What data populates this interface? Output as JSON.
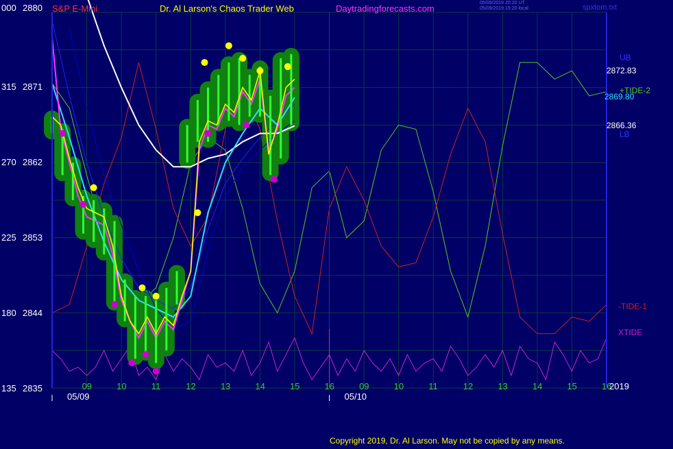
{
  "header": {
    "symbol": "S&P E-Mini",
    "title": "Dr. Al Larson's Chaos Trader Web",
    "site": "Daytradingforecasts.com",
    "stamp_ut": "05/09/2019 20:20 UT",
    "stamp_local": "05/09/2019 15:20 local",
    "filename": "spxtom.txt"
  },
  "copyright": "Copyright 2019, Dr. Al Larson. May not be copied by any means.",
  "colors": {
    "background": "#000066",
    "grid": "#0a3a40",
    "price_hull": "#108010",
    "price_bar": "#30ff30",
    "price_close": "#ffff00",
    "high_marker": "#ffff00",
    "low_marker": "#cc00cc",
    "magenta_avg": "#ff33ff",
    "cyan_avg": "#33ddff",
    "white_avg": "#ffffff",
    "blue_avg1": "#2020ff",
    "blue_avg2": "#0000cc",
    "tide_plus": "#55cc22",
    "tide_minus": "#cc2222",
    "xtide": "#cc22cc",
    "now_line": "#2222dd"
  },
  "chart_data": {
    "type": "line",
    "title": "S&P E-Mini",
    "xlabel": "",
    "ylabel": "",
    "grid": true,
    "hour_ticks": [
      "09",
      "10",
      "11",
      "12",
      "13",
      "14",
      "15",
      "16",
      "09",
      "10",
      "11",
      "12",
      "13",
      "14",
      "15",
      "16"
    ],
    "date_labels": [
      "05/09",
      "05/10"
    ],
    "year_label": "2019",
    "y_ticks": [
      {
        "left": "135",
        "price": "2835"
      },
      {
        "left": "180",
        "price": "2844"
      },
      {
        "left": "225",
        "price": "2853"
      },
      {
        "left": "270",
        "price": "2862"
      },
      {
        "left": "315",
        "price": "2871"
      },
      {
        "left": "000",
        "price": "2880"
      }
    ],
    "ylim": [
      2835,
      2880
    ],
    "right_labels": {
      "ub": "UB",
      "ub_value": "2872.83",
      "cyan_value": "2869.80",
      "lb_value": "2866.36",
      "lb": "LB",
      "tide2": "+TIDE-2",
      "tide1": "-TIDE-1",
      "xtide": "XTIDE"
    },
    "series": [
      {
        "name": "price_close",
        "x": [
          0.0,
          0.25,
          0.5,
          0.75,
          1.0,
          1.25,
          1.5,
          1.75,
          2.0,
          2.25,
          2.5,
          2.75,
          3.0,
          3.25,
          3.5,
          3.75,
          4.0,
          4.25,
          4.5,
          4.75,
          5.0,
          5.25,
          5.5,
          5.75,
          6.0,
          6.25,
          6.5,
          6.75,
          7.0
        ],
        "values": [
          2867.5,
          2866.5,
          2862.5,
          2859.0,
          2856.5,
          2856.0,
          2855.5,
          2852.0,
          2846.0,
          2843.0,
          2841.5,
          2843.5,
          2841.5,
          2843.5,
          2842.5,
          2846.0,
          2849.0,
          2864.5,
          2867.0,
          2866.5,
          2869.0,
          2868.0,
          2871.0,
          2869.5,
          2873.0,
          2863.0,
          2866.5,
          2871.0,
          2872.0
        ]
      },
      {
        "name": "magenta_avg",
        "x": [
          0.0,
          0.25,
          0.5,
          0.75,
          1.0,
          1.25,
          1.5,
          1.75,
          2.0,
          2.25,
          2.5,
          2.75,
          3.0,
          3.25,
          3.5,
          3.75,
          4.0,
          4.25,
          4.5,
          4.75,
          5.0,
          5.25,
          5.5,
          5.75,
          6.0,
          6.25,
          6.5,
          6.75,
          7.0
        ],
        "values": [
          2877.0,
          2866.0,
          2862.0,
          2858.0,
          2855.5,
          2855.0,
          2854.5,
          2851.0,
          2845.5,
          2843.0,
          2841.0,
          2843.0,
          2841.0,
          2843.0,
          2842.0,
          2845.5,
          2849.0,
          2863.5,
          2866.5,
          2866.0,
          2868.5,
          2867.5,
          2870.5,
          2869.0,
          2872.0,
          2863.5,
          2866.0,
          2870.0,
          2871.0
        ]
      },
      {
        "name": "cyan_avg",
        "x": [
          0.0,
          0.5,
          1.0,
          1.5,
          2.0,
          2.5,
          3.0,
          3.5,
          4.0,
          4.5,
          5.0,
          5.5,
          6.0,
          6.5,
          7.0
        ],
        "values": [
          2871.5,
          2865.0,
          2858.0,
          2852.5,
          2848.0,
          2845.5,
          2844.5,
          2843.5,
          2846.0,
          2856.0,
          2862.0,
          2865.5,
          2868.5,
          2866.5,
          2869.8
        ]
      },
      {
        "name": "white_avg",
        "x": [
          1.0,
          1.5,
          2.0,
          2.5,
          3.0,
          3.5,
          4.0,
          4.5,
          5.0,
          5.5,
          6.0,
          6.5,
          7.0
        ],
        "values": [
          2882.0,
          2876.0,
          2871.0,
          2866.5,
          2863.5,
          2861.5,
          2861.5,
          2862.5,
          2863.0,
          2864.5,
          2865.5,
          2865.5,
          2866.4
        ]
      },
      {
        "name": "blue_avg1",
        "x": [
          0.0,
          0.5,
          1.0,
          1.5,
          2.0,
          2.5,
          3.0,
          3.5,
          4.0,
          4.5,
          5.0,
          5.5,
          6.0,
          6.5,
          7.0
        ],
        "values": [
          2879.0,
          2870.0,
          2862.0,
          2855.5,
          2850.5,
          2847.0,
          2845.5,
          2844.5,
          2847.0,
          2854.0,
          2859.5,
          2862.5,
          2865.0,
          2867.0,
          2869.0
        ]
      },
      {
        "name": "blue_avg2",
        "x": [
          0.5,
          1.0,
          1.5,
          2.0,
          2.5,
          3.0,
          3.5,
          4.0,
          4.5,
          5.0,
          5.5,
          6.0,
          6.5,
          7.0
        ],
        "values": [
          2878.0,
          2868.5,
          2860.5,
          2854.5,
          2849.0,
          2844.5,
          2842.0,
          2843.0,
          2851.5,
          2858.0,
          2861.5,
          2863.5,
          2865.5,
          2867.0
        ]
      },
      {
        "name": "+TIDE-2",
        "x": [
          0.0,
          0.5,
          1.0,
          1.5,
          2.0,
          2.5,
          3.0,
          3.5,
          4.0,
          4.5,
          5.0,
          5.5,
          6.0,
          6.5,
          7.0,
          7.5,
          8.0,
          8.5,
          9.0,
          9.5,
          10.0,
          10.5,
          11.0,
          11.5,
          12.0,
          12.5,
          13.0,
          13.5,
          14.0,
          14.5,
          15.0,
          15.5,
          16.0
        ],
        "values": [
          2871.5,
          2868.5,
          2860.5,
          2853.0,
          2847.0,
          2845.0,
          2847.0,
          2853.0,
          2862.0,
          2865.0,
          2863.5,
          2856.5,
          2847.5,
          2844.0,
          2849.0,
          2859.0,
          2861.0,
          2853.0,
          2855.0,
          2863.5,
          2866.5,
          2866.0,
          2858.5,
          2849.0,
          2843.5,
          2852.0,
          2864.0,
          2874.0,
          2874.0,
          2872.0,
          2873.0,
          2870.0,
          2870.5
        ]
      },
      {
        "name": "-TIDE-1",
        "x": [
          0.0,
          0.5,
          1.0,
          1.5,
          2.0,
          2.5,
          3.0,
          3.5,
          4.0,
          4.5,
          5.0,
          5.5,
          6.0,
          6.5,
          7.0,
          7.5,
          8.0,
          8.5,
          9.0,
          9.5,
          10.0,
          10.5,
          11.0,
          11.5,
          12.0,
          12.5,
          13.0,
          13.5,
          14.0,
          14.5,
          15.0,
          15.5,
          16.0
        ],
        "values": [
          2844.0,
          2845.0,
          2852.0,
          2859.5,
          2865.0,
          2874.0,
          2866.0,
          2856.5,
          2852.0,
          2855.5,
          2866.0,
          2870.5,
          2866.0,
          2855.0,
          2846.0,
          2841.5,
          2856.5,
          2861.5,
          2857.5,
          2852.0,
          2849.5,
          2850.0,
          2855.5,
          2863.0,
          2868.5,
          2864.5,
          2853.5,
          2843.5,
          2841.5,
          2841.5,
          2843.5,
          2843.0,
          2845.0
        ]
      },
      {
        "name": "XTIDE",
        "x": [
          0.0,
          0.25,
          0.5,
          0.75,
          1.0,
          1.25,
          1.5,
          1.75,
          2.0,
          2.25,
          2.5,
          2.75,
          3.0,
          3.25,
          3.5,
          3.75,
          4.0,
          4.25,
          4.5,
          4.75,
          5.0,
          5.25,
          5.5,
          5.75,
          6.0,
          6.25,
          6.5,
          6.75,
          7.0,
          7.25,
          7.5,
          7.75,
          8.0,
          8.25,
          8.5,
          8.75,
          9.0,
          9.25,
          9.5,
          9.75,
          10.0,
          10.25,
          10.5,
          10.75,
          11.0,
          11.25,
          11.5,
          11.75,
          12.0,
          12.25,
          12.5,
          12.75,
          13.0,
          13.25,
          13.5,
          13.75,
          14.0,
          14.25,
          14.5,
          14.75,
          15.0,
          15.25,
          15.5,
          15.75,
          16.0
        ],
        "values": [
          2839.5,
          2838.5,
          2837.0,
          2837.5,
          2836.5,
          2837.5,
          2839.5,
          2837.0,
          2838.5,
          2840.0,
          2836.5,
          2837.5,
          2836.0,
          2839.0,
          2837.0,
          2838.5,
          2837.5,
          2836.0,
          2839.0,
          2837.5,
          2838.0,
          2837.0,
          2839.5,
          2836.5,
          2838.0,
          2840.5,
          2837.0,
          2839.0,
          2841.0,
          2838.0,
          2836.0,
          2837.5,
          2839.0,
          2836.5,
          2838.5,
          2837.0,
          2839.5,
          2838.0,
          2837.0,
          2838.5,
          2836.5,
          2839.0,
          2837.0,
          2838.0,
          2838.5,
          2837.0,
          2840.0,
          2838.5,
          2836.5,
          2837.5,
          2839.0,
          2837.5,
          2839.5,
          2836.5,
          2840.0,
          2838.5,
          2838.0,
          2836.0,
          2840.5,
          2839.0,
          2837.0,
          2839.5,
          2838.0,
          2838.5,
          2841.0
        ]
      }
    ],
    "price_bars": {
      "x": [
        0.0,
        0.3,
        0.6,
        0.9,
        1.2,
        1.5,
        1.8,
        2.1,
        2.4,
        2.7,
        3.0,
        3.3,
        3.6,
        3.9,
        4.2,
        4.5,
        4.8,
        5.1,
        5.4,
        5.7,
        6.0,
        6.3,
        6.6,
        6.9
      ],
      "high": [
        2867.5,
        2866.0,
        2862.0,
        2858.0,
        2857.5,
        2856.5,
        2855.0,
        2848.0,
        2846.0,
        2846.0,
        2845.5,
        2847.0,
        2849.0,
        2866.5,
        2869.5,
        2871.0,
        2872.5,
        2874.0,
        2874.5,
        2872.5,
        2873.5,
        2870.0,
        2874.5,
        2875.0
      ],
      "low": [
        2865.5,
        2860.5,
        2857.5,
        2853.5,
        2852.5,
        2851.0,
        2845.0,
        2843.0,
        2838.5,
        2839.0,
        2838.0,
        2839.5,
        2845.0,
        2862.0,
        2864.5,
        2864.5,
        2866.5,
        2867.0,
        2866.5,
        2867.5,
        2867.5,
        2860.5,
        2862.5,
        2866.5
      ]
    },
    "highs": {
      "x": [
        1.2,
        2.6,
        3.0,
        4.2,
        4.4,
        5.1,
        5.5,
        6.0,
        6.8
      ],
      "values": [
        2859.0,
        2847.0,
        2846.0,
        2856.0,
        2874.0,
        2876.0,
        2874.5,
        2873.0,
        2873.5
      ]
    },
    "lows": {
      "x": [
        0.3,
        0.9,
        1.8,
        2.3,
        2.7,
        3.0,
        4.5,
        5.6,
        6.4
      ],
      "values": [
        2865.5,
        2857.0,
        2845.0,
        2838.0,
        2839.0,
        2837.0,
        2865.5,
        2866.5,
        2860.0
      ]
    }
  }
}
